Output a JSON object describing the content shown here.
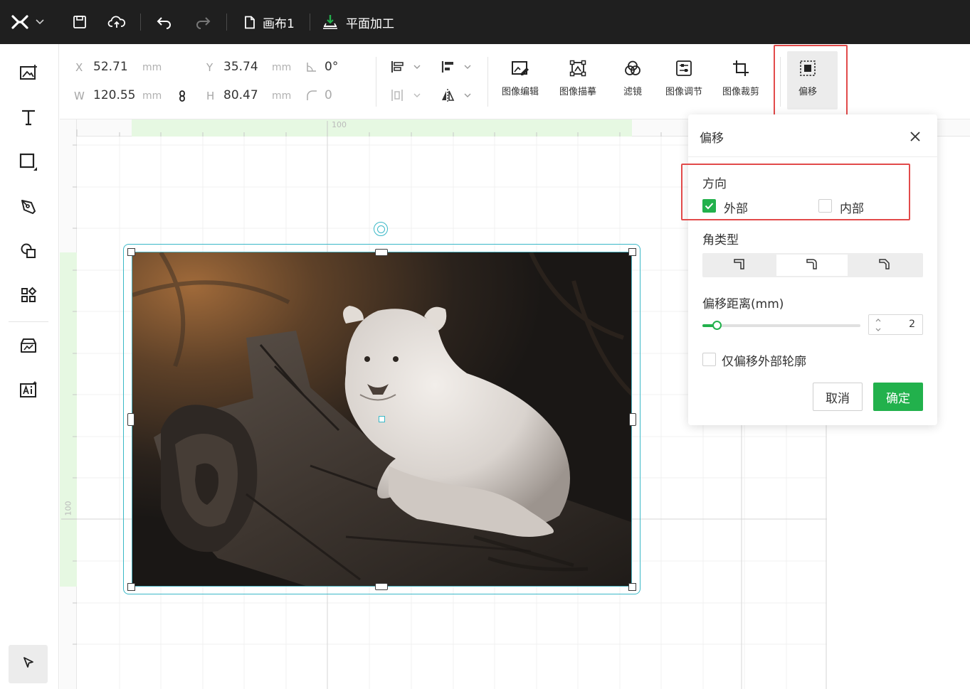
{
  "topbar": {
    "doc_title": "画布1",
    "mode_label": "平面加工"
  },
  "props": {
    "x_label": "X",
    "x_value": "52.71",
    "x_unit": "mm",
    "y_label": "Y",
    "y_value": "35.74",
    "y_unit": "mm",
    "w_label": "W",
    "w_value": "120.55",
    "w_unit": "mm",
    "h_label": "H",
    "h_value": "80.47",
    "h_unit": "mm",
    "rotation_value": "0°",
    "corner_value": "0"
  },
  "tools": {
    "image_edit": "图像编辑",
    "image_trace": "图像描摹",
    "filter": "滤镜",
    "image_adjust": "图像调节",
    "image_crop": "图像裁剪",
    "offset": "偏移"
  },
  "rulers": {
    "h_mark": "100",
    "v_mark": "100"
  },
  "dialog": {
    "title": "偏移",
    "direction_label": "方向",
    "outer_label": "外部",
    "outer_checked": true,
    "inner_label": "内部",
    "inner_checked": false,
    "corner_type_label": "角类型",
    "corner_selected_index": 1,
    "distance_label": "偏移距离(mm)",
    "distance_value": "2",
    "outer_contour_only_label": "仅偏移外部轮廓",
    "outer_contour_only_checked": false,
    "cancel_label": "取消",
    "ok_label": "确定"
  },
  "colors": {
    "accent": "#22b14c",
    "selection": "#3ab8c7",
    "highlight_box": "#e24a4a",
    "topbar_bg": "#1f1f1f"
  }
}
